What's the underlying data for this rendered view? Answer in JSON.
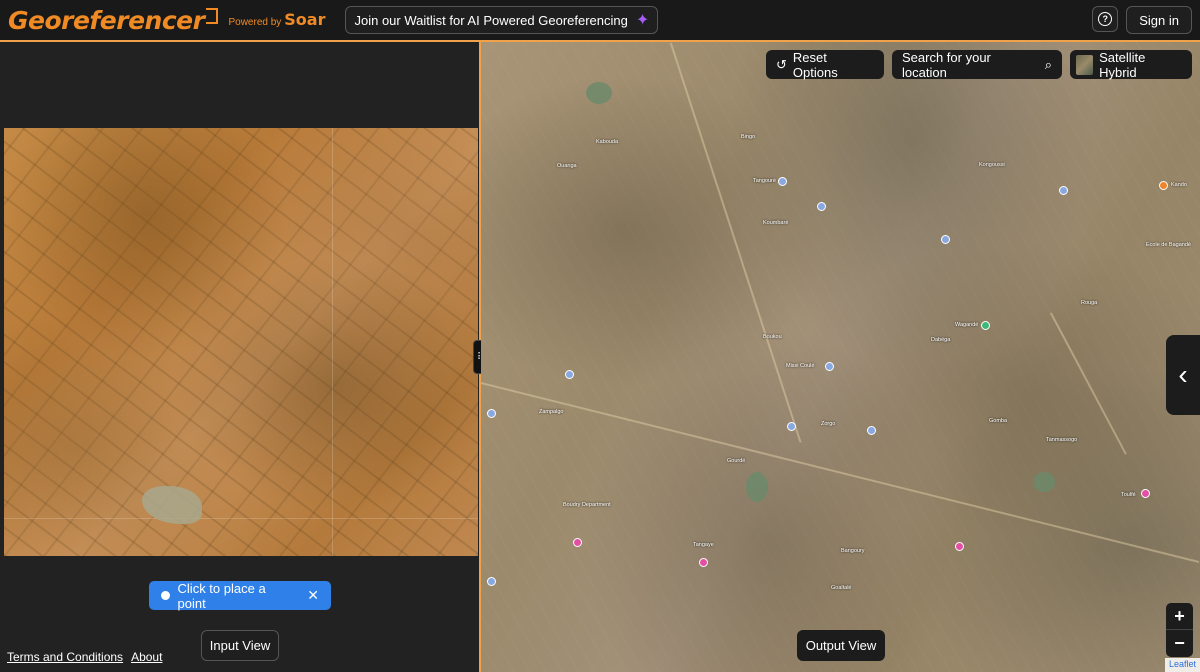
{
  "header": {
    "logo_text": "Georeferencer",
    "powered_by": "Powered by",
    "brand": "Soar",
    "waitlist_label": "Join our Waitlist for AI Powered Georeferencing",
    "help_icon": "?",
    "signin_label": "Sign in"
  },
  "left_panel": {
    "place_point_label": "Click to place a point",
    "close_icon": "✕",
    "input_view_label": "Input View",
    "footer": {
      "terms": "Terms and Conditions",
      "about": "About"
    }
  },
  "map": {
    "reset_label": "Reset Options",
    "search_label": "Search for your location",
    "layer_label": "Satellite Hybrid",
    "output_view_label": "Output View",
    "zoom_in": "+",
    "zoom_out": "−",
    "attribution": "Leaflet",
    "labels": [
      "Kabouda",
      "Ouanga",
      "Bingo",
      "Tangouré",
      "Koumbaré",
      "Dabéga",
      "Kongoussi",
      "Kando",
      "Wagandé",
      "Boukou",
      "Missi Coulé",
      "Zampalgo",
      "Zorgo",
      "Gourdé",
      "Boudry Department",
      "Bangoury",
      "Tanmassogo",
      "Toulfé",
      "Gomba",
      "Tangaye",
      "Goaltalé",
      "Ecole de Bagandé",
      "Rouga"
    ]
  }
}
